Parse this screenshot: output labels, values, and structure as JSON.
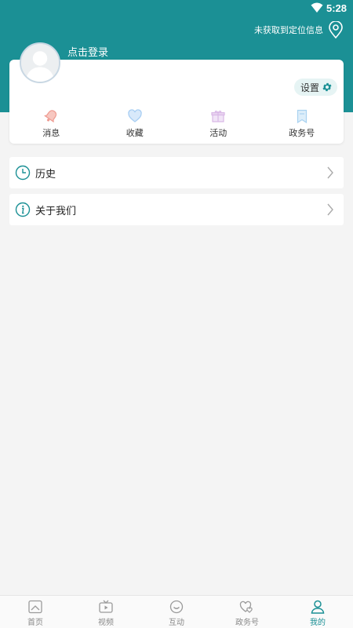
{
  "status_bar": {
    "time": "5:28"
  },
  "header": {
    "location_text": "未获取到定位信息",
    "login_text": "点击登录"
  },
  "profile": {
    "settings_label": "设置"
  },
  "quick_actions": [
    {
      "label": "消息",
      "icon": "bell-icon",
      "color": "#f1a49b"
    },
    {
      "label": "收藏",
      "icon": "heart-icon",
      "color": "#a9cff3"
    },
    {
      "label": "活动",
      "icon": "gift-icon",
      "color": "#d9b8e6"
    },
    {
      "label": "政务号",
      "icon": "bookmark-icon",
      "color": "#a9d2f0"
    }
  ],
  "menu": [
    {
      "label": "历史",
      "icon": "clock-icon"
    },
    {
      "label": "关于我们",
      "icon": "info-icon"
    }
  ],
  "bottom_nav": [
    {
      "label": "首页",
      "icon": "home-icon",
      "active": false
    },
    {
      "label": "视频",
      "icon": "tv-icon",
      "active": false
    },
    {
      "label": "互动",
      "icon": "chat-icon",
      "active": false
    },
    {
      "label": "政务号",
      "icon": "hearts-icon",
      "active": false
    },
    {
      "label": "我的",
      "icon": "user-icon",
      "active": true
    }
  ],
  "colors": {
    "accent": "#1b9095",
    "page_bg": "#f4f4f4"
  }
}
